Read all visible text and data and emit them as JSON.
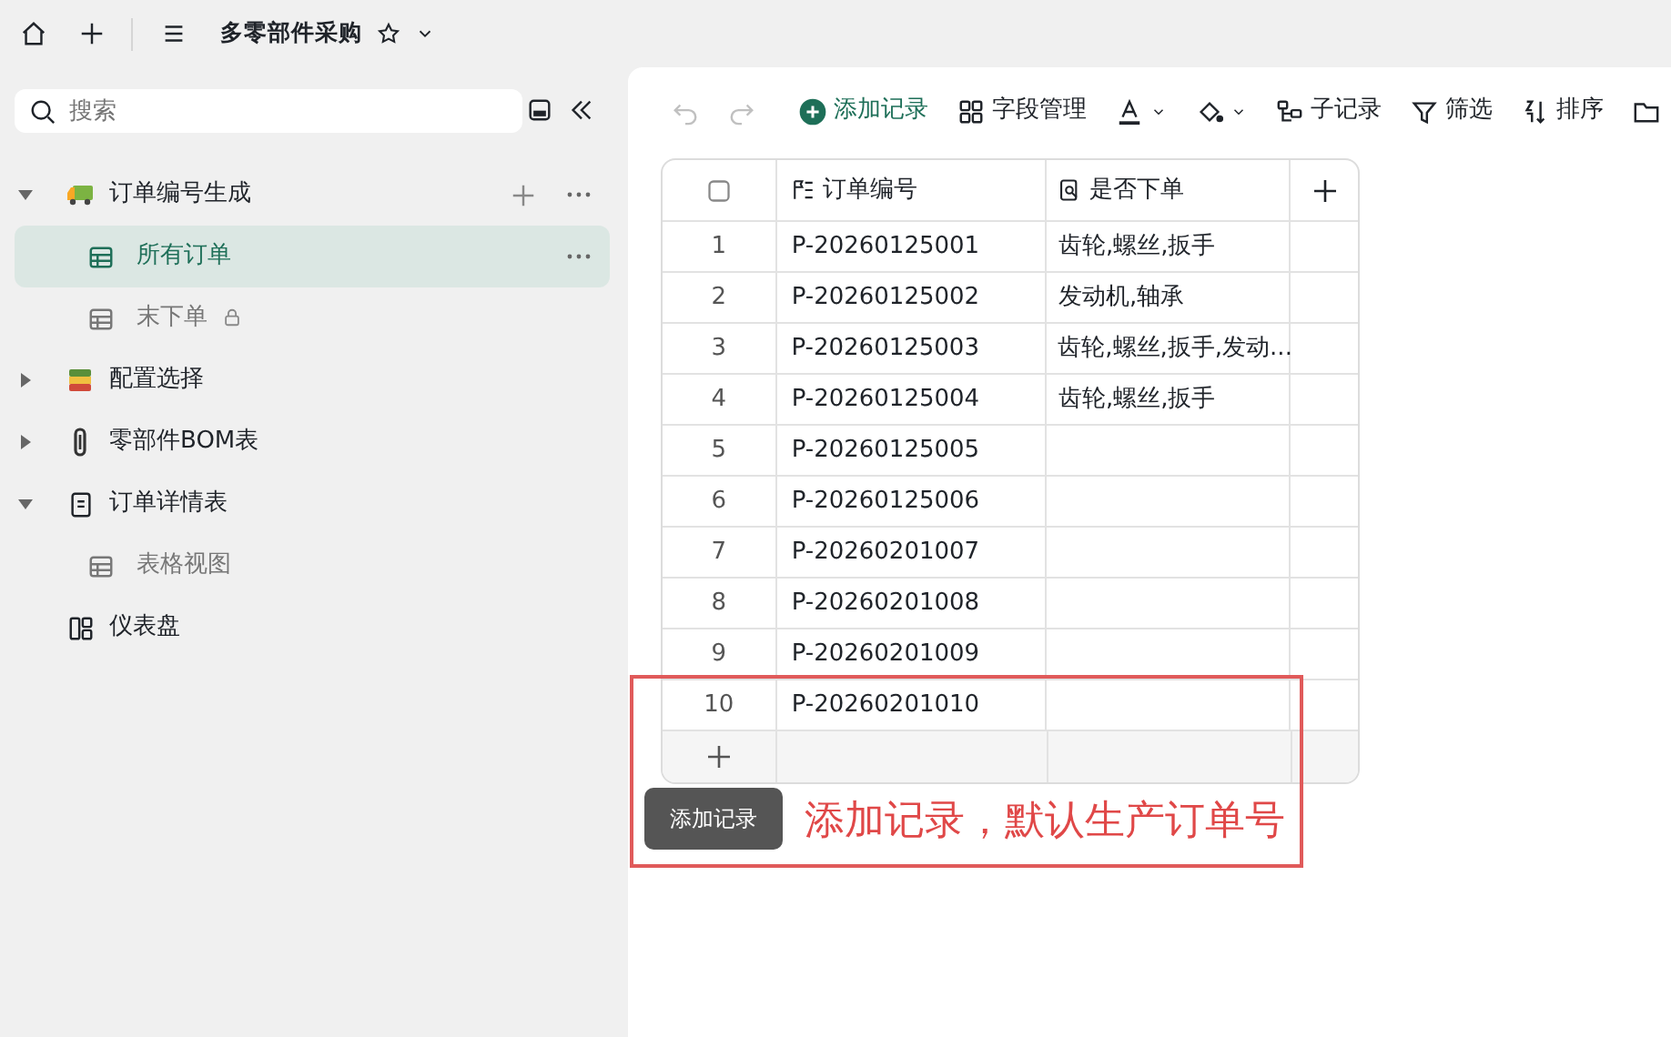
{
  "app": {
    "title": "多零部件采购",
    "starred": false
  },
  "search": {
    "placeholder": "搜索"
  },
  "sidebar": {
    "items": [
      {
        "label": "订单编号生成",
        "kind": "truck",
        "expanded": true,
        "selected": false,
        "children": [
          {
            "label": "所有订单",
            "kind": "grid",
            "selected": true,
            "locked": false
          },
          {
            "label": "末下单",
            "kind": "grid",
            "selected": false,
            "locked": true
          }
        ]
      },
      {
        "label": "配置选择",
        "kind": "stack",
        "expanded": false,
        "selected": false
      },
      {
        "label": "零部件BOM表",
        "kind": "clip",
        "expanded": false,
        "selected": false
      },
      {
        "label": "订单详情表",
        "kind": "doc",
        "expanded": true,
        "selected": false,
        "children": [
          {
            "label": "表格视图",
            "kind": "grid",
            "selected": false,
            "locked": false
          }
        ]
      },
      {
        "label": "仪表盘",
        "kind": "dashboard",
        "selected": false
      }
    ]
  },
  "toolbar": {
    "buttons": [
      {
        "kind": "undo",
        "disabled": true
      },
      {
        "kind": "redo",
        "disabled": true
      },
      {
        "kind": "add",
        "label": "添加记录",
        "disabled": false
      },
      {
        "kind": "fields",
        "label": "字段管理",
        "disabled": false
      },
      {
        "kind": "text-color",
        "disabled": false
      },
      {
        "kind": "fill-color",
        "disabled": false
      },
      {
        "kind": "subrecord",
        "label": "子记录",
        "disabled": false
      },
      {
        "kind": "filter",
        "label": "筛选",
        "disabled": false
      },
      {
        "kind": "sort",
        "label": "排序",
        "disabled": false
      },
      {
        "kind": "folder",
        "disabled": false
      }
    ]
  },
  "table": {
    "select_all": {
      "checked": false
    },
    "columns": [
      {
        "label": "订单编号",
        "kind": "autonumber"
      },
      {
        "label": "是否下单",
        "kind": "lookup"
      }
    ],
    "rows": [
      {
        "index": "1",
        "order_no": "P-20260125001",
        "parts": "齿轮,螺丝,扳手"
      },
      {
        "index": "2",
        "order_no": "P-20260125002",
        "parts": "发动机,轴承"
      },
      {
        "index": "3",
        "order_no": "P-20260125003",
        "parts": "齿轮,螺丝,扳手,发动..."
      },
      {
        "index": "4",
        "order_no": "P-20260125004",
        "parts": "齿轮,螺丝,扳手"
      },
      {
        "index": "5",
        "order_no": "P-20260125005"
      },
      {
        "index": "6",
        "order_no": "P-20260125006"
      },
      {
        "index": "7",
        "order_no": "P-20260201007"
      },
      {
        "index": "8",
        "order_no": "P-20260201008"
      },
      {
        "index": "9",
        "order_no": "P-20260201009"
      },
      {
        "index": "10",
        "order_no": "P-20260201010"
      }
    ]
  },
  "tooltip": "添加记录",
  "annotation": "添加记录，默认生产订单号"
}
